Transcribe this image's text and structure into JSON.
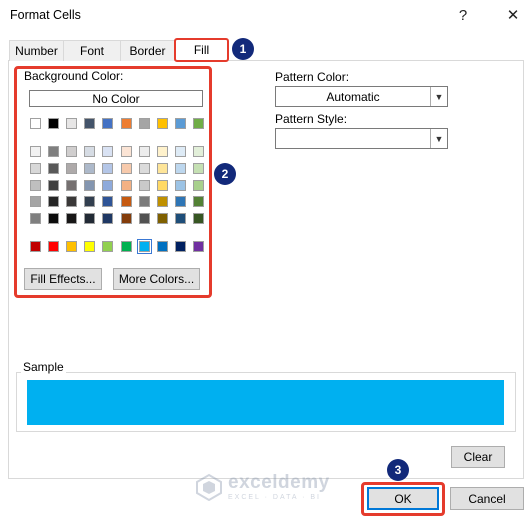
{
  "window": {
    "title": "Format Cells",
    "help_glyph": "?",
    "close_glyph": "✕"
  },
  "tabs": [
    {
      "label": "Number"
    },
    {
      "label": "Font"
    },
    {
      "label": "Border"
    },
    {
      "label": "Fill",
      "active": true
    }
  ],
  "fill": {
    "background_color_label": "Background Color:",
    "no_color_label": "No Color",
    "theme_top_row": [
      "#ffffff",
      "#000000",
      "#e7e6e6",
      "#44546a",
      "#4472c4",
      "#ed7d31",
      "#a5a5a5",
      "#ffc000",
      "#5b9bd5",
      "#70ad47"
    ],
    "theme_shades": [
      [
        "#f2f2f2",
        "#7f7f7f",
        "#d0cece",
        "#d6dce4",
        "#d9e2f3",
        "#fbe4d5",
        "#ededed",
        "#fff2cc",
        "#deebf6",
        "#e2efd9"
      ],
      [
        "#d8d8d8",
        "#595959",
        "#aeaaaa",
        "#adb9ca",
        "#b4c6e7",
        "#f7caac",
        "#dbdbdb",
        "#fee599",
        "#bdd7ee",
        "#c5e0b3"
      ],
      [
        "#bfbfbf",
        "#3f3f3f",
        "#757070",
        "#8496b0",
        "#8eaadb",
        "#f4b183",
        "#c9c9c9",
        "#ffd965",
        "#9cc3e5",
        "#a8d08d"
      ],
      [
        "#a5a5a5",
        "#262626",
        "#3a3838",
        "#323f4f",
        "#2f5496",
        "#c55a11",
        "#7b7b7b",
        "#bf9000",
        "#2e75b5",
        "#538135"
      ],
      [
        "#7f7f7f",
        "#0c0c0c",
        "#171616",
        "#222a35",
        "#1f3864",
        "#833c0b",
        "#525252",
        "#7f6000",
        "#1e4e79",
        "#375623"
      ]
    ],
    "standard_colors": [
      "#c00000",
      "#ff0000",
      "#ffc000",
      "#ffff00",
      "#92d050",
      "#00b050",
      "#00b0f0",
      "#0070c0",
      "#002060",
      "#7030a0"
    ],
    "selected_standard_index": 6,
    "fill_effects_label": "Fill Effects...",
    "more_colors_label": "More Colors...",
    "pattern_color_label": "Pattern Color:",
    "pattern_color_value": "Automatic",
    "pattern_style_label": "Pattern Style:",
    "pattern_style_value": "",
    "sample_label": "Sample",
    "sample_color": "#00b0f0",
    "clear_label": "Clear"
  },
  "footer": {
    "ok_label": "OK",
    "cancel_label": "Cancel"
  },
  "annotations": {
    "step1": "1",
    "step2": "2",
    "step3": "3",
    "highlight_color": "#e53b2c",
    "badge_color": "#12297a"
  },
  "watermark": {
    "name": "exceldemy",
    "tagline": "EXCEL · DATA · BI"
  }
}
